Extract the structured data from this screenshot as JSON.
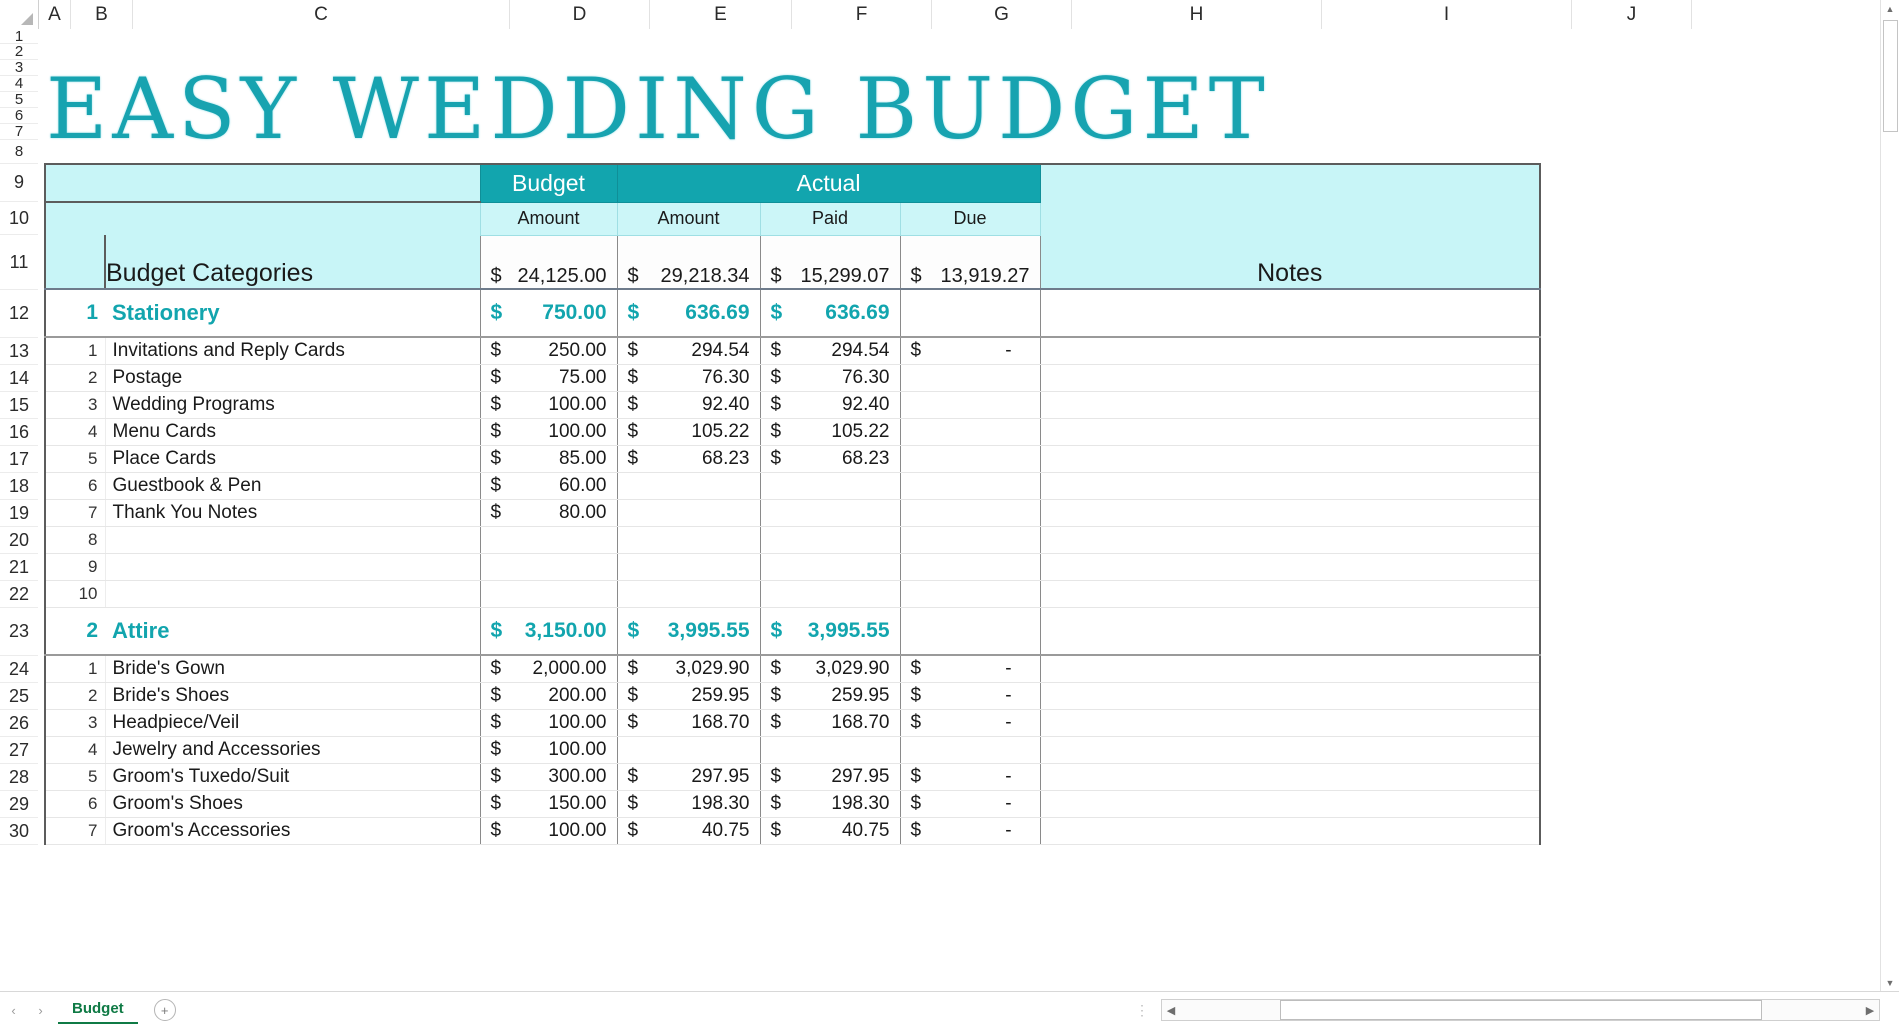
{
  "sheet_title": "EASY WEDDING BUDGET",
  "column_headers": [
    "A",
    "B",
    "C",
    "D",
    "E",
    "F",
    "G",
    "H",
    "I",
    "J"
  ],
  "row_headers": [
    "1",
    "2",
    "3",
    "4",
    "5",
    "6",
    "7",
    "8",
    "9",
    "10",
    "11",
    "12",
    "13",
    "14",
    "15",
    "16",
    "17",
    "18",
    "19",
    "20",
    "21",
    "22",
    "23",
    "24",
    "25",
    "26",
    "27",
    "28",
    "29",
    "30"
  ],
  "table": {
    "group_headers": {
      "budget": "Budget",
      "actual": "Actual"
    },
    "sub_headers": {
      "budget_amount": "Amount",
      "actual_amount": "Amount",
      "paid": "Paid",
      "due": "Due"
    },
    "categories_label": "Budget Categories",
    "notes_label": "Notes",
    "totals": {
      "budget_amount": "24,125.00",
      "actual_amount": "29,218.34",
      "paid": "15,299.07",
      "due": "13,919.27"
    },
    "currency_symbol": "$",
    "sections": [
      {
        "number": "1",
        "name": "Stationery",
        "budget_amount": "750.00",
        "actual_amount": "636.69",
        "paid": "636.69",
        "due": "",
        "notes": "",
        "items": [
          {
            "number": "1",
            "name": "Invitations and Reply Cards",
            "budget_amount": "250.00",
            "actual_amount": "294.54",
            "paid": "294.54",
            "due": "-",
            "notes": ""
          },
          {
            "number": "2",
            "name": "Postage",
            "budget_amount": "75.00",
            "actual_amount": "76.30",
            "paid": "76.30",
            "due": "",
            "notes": ""
          },
          {
            "number": "3",
            "name": "Wedding Programs",
            "budget_amount": "100.00",
            "actual_amount": "92.40",
            "paid": "92.40",
            "due": "",
            "notes": ""
          },
          {
            "number": "4",
            "name": "Menu Cards",
            "budget_amount": "100.00",
            "actual_amount": "105.22",
            "paid": "105.22",
            "due": "",
            "notes": ""
          },
          {
            "number": "5",
            "name": "Place Cards",
            "budget_amount": "85.00",
            "actual_amount": "68.23",
            "paid": "68.23",
            "due": "",
            "notes": ""
          },
          {
            "number": "6",
            "name": "Guestbook & Pen",
            "budget_amount": "60.00",
            "actual_amount": "",
            "paid": "",
            "due": "",
            "notes": ""
          },
          {
            "number": "7",
            "name": "Thank You Notes",
            "budget_amount": "80.00",
            "actual_amount": "",
            "paid": "",
            "due": "",
            "notes": ""
          },
          {
            "number": "8",
            "name": "",
            "budget_amount": "",
            "actual_amount": "",
            "paid": "",
            "due": "",
            "notes": ""
          },
          {
            "number": "9",
            "name": "",
            "budget_amount": "",
            "actual_amount": "",
            "paid": "",
            "due": "",
            "notes": ""
          },
          {
            "number": "10",
            "name": "",
            "budget_amount": "",
            "actual_amount": "",
            "paid": "",
            "due": "",
            "notes": ""
          }
        ]
      },
      {
        "number": "2",
        "name": "Attire",
        "budget_amount": "3,150.00",
        "actual_amount": "3,995.55",
        "paid": "3,995.55",
        "due": "",
        "notes": "",
        "items": [
          {
            "number": "1",
            "name": "Bride's Gown",
            "budget_amount": "2,000.00",
            "actual_amount": "3,029.90",
            "paid": "3,029.90",
            "due": "-",
            "notes": ""
          },
          {
            "number": "2",
            "name": "Bride's Shoes",
            "budget_amount": "200.00",
            "actual_amount": "259.95",
            "paid": "259.95",
            "due": "-",
            "notes": ""
          },
          {
            "number": "3",
            "name": "Headpiece/Veil",
            "budget_amount": "100.00",
            "actual_amount": "168.70",
            "paid": "168.70",
            "due": "-",
            "notes": ""
          },
          {
            "number": "4",
            "name": "Jewelry and Accessories",
            "budget_amount": "100.00",
            "actual_amount": "",
            "paid": "",
            "due": "",
            "notes": ""
          },
          {
            "number": "5",
            "name": "Groom's Tuxedo/Suit",
            "budget_amount": "300.00",
            "actual_amount": "297.95",
            "paid": "297.95",
            "due": "-",
            "notes": ""
          },
          {
            "number": "6",
            "name": "Groom's Shoes",
            "budget_amount": "150.00",
            "actual_amount": "198.30",
            "paid": "198.30",
            "due": "-",
            "notes": ""
          },
          {
            "number": "7",
            "name": "Groom's Accessories",
            "budget_amount": "100.00",
            "actual_amount": "40.75",
            "paid": "40.75",
            "due": "-",
            "notes": ""
          }
        ]
      }
    ]
  },
  "bottom_bar": {
    "sheet_tab": "Budget",
    "add_sheet": "+",
    "nav_prev": "‹",
    "nav_next": "›",
    "scroll_left": "◀",
    "scroll_right": "▶"
  },
  "colors": {
    "accent_teal": "#12a5ae",
    "header_fill": "#c8f5f7",
    "subheader_fill": "#ccf6f8",
    "title_color": "#17a3b0"
  }
}
